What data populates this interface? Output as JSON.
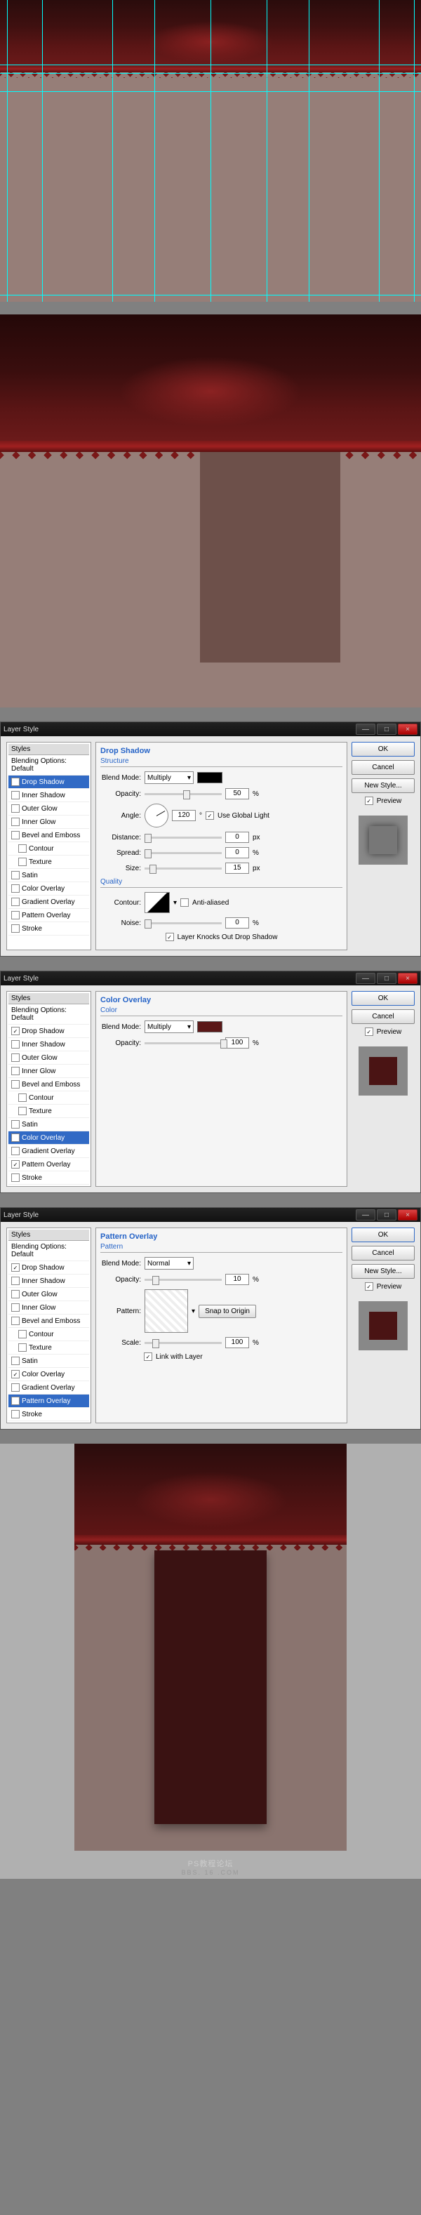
{
  "dialog_title": "Layer Style",
  "win_close": "×",
  "styles_header": "Styles",
  "blending_default": "Blending Options: Default",
  "fx": {
    "drop_shadow": "Drop Shadow",
    "inner_shadow": "Inner Shadow",
    "outer_glow": "Outer Glow",
    "inner_glow": "Inner Glow",
    "bevel": "Bevel and Emboss",
    "contour": "Contour",
    "texture": "Texture",
    "satin": "Satin",
    "color_overlay": "Color Overlay",
    "gradient_overlay": "Gradient Overlay",
    "pattern_overlay": "Pattern Overlay",
    "stroke": "Stroke"
  },
  "labels": {
    "structure": "Structure",
    "quality": "Quality",
    "color": "Color",
    "pattern": "Pattern",
    "blend_mode": "Blend Mode:",
    "opacity": "Opacity:",
    "angle": "Angle:",
    "distance": "Distance:",
    "spread": "Spread:",
    "size": "Size:",
    "contour": "Contour:",
    "noise": "Noise:",
    "pattern_label": "Pattern:",
    "scale": "Scale:",
    "use_global": "Use Global Light",
    "anti_aliased": "Anti-aliased",
    "knocks_out": "Layer Knocks Out Drop Shadow",
    "snap_origin": "Snap to Origin",
    "link_layer": "Link with Layer",
    "percent": "%",
    "px": "px",
    "deg": "°"
  },
  "buttons": {
    "ok": "OK",
    "cancel": "Cancel",
    "new_style": "New Style...",
    "preview": "Preview"
  },
  "dropshadow": {
    "blend_mode": "Multiply",
    "opacity": "50",
    "angle": "120",
    "distance": "0",
    "spread": "0",
    "size": "15",
    "noise": "0",
    "shadow_color": "#000000"
  },
  "coloroverlay": {
    "blend_mode": "Multiply",
    "opacity": "100",
    "color": "#5a1818"
  },
  "patternoverlay": {
    "blend_mode": "Normal",
    "opacity": "10",
    "scale": "100"
  },
  "guides_v": [
    10,
    60,
    160,
    220,
    300,
    380,
    440,
    540,
    590
  ],
  "guides_h": [
    92,
    104,
    130,
    420
  ],
  "footer": {
    "title": "PS教程论坛",
    "sub": "BBS. 16    .COM"
  }
}
